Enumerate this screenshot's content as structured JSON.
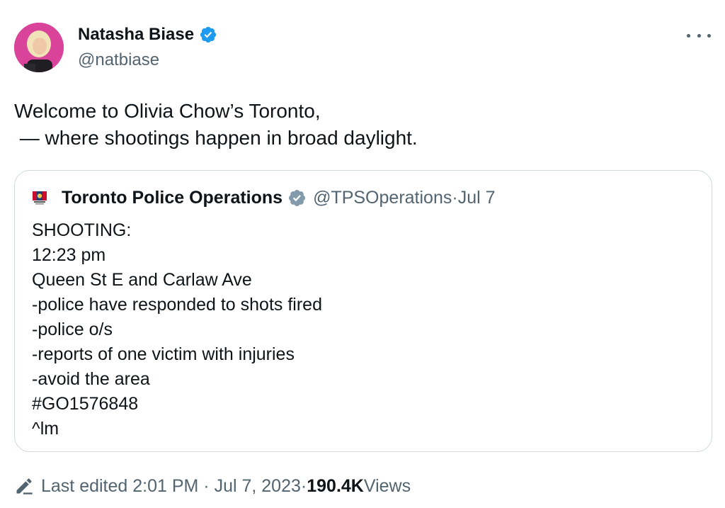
{
  "tweet": {
    "author_name": "Natasha Biase",
    "author_handle": "@natbiase",
    "text_lines": [
      "Welcome to Olivia Chow’s Toronto,",
      " — where shootings happen in broad daylight."
    ]
  },
  "quote": {
    "author_name": "Toronto Police Operations",
    "author_handle": "@TPSOperations",
    "separator": " · ",
    "date": "Jul 7",
    "lines": [
      "SHOOTING:",
      "12:23 pm",
      "Queen St E and Carlaw Ave",
      "-police have responded to shots fired",
      "-police o/s",
      "-reports of one victim with injuries",
      "-avoid the area",
      "#GO1576848",
      "^lm"
    ]
  },
  "footer": {
    "edited_label": "Last edited 2:01 PM · Jul 7, 2023",
    "separator": " · ",
    "views_count": "190.4K",
    "views_label": " Views"
  },
  "icons": {
    "verified": "verified-badge-icon",
    "more": "more-options-icon",
    "edit": "pencil-edit-icon"
  },
  "colors": {
    "verified_blue": "#1d9bf0",
    "verified_gray": "#829aab",
    "secondary_text": "#536471",
    "avatar_bg": "#d9439a"
  }
}
